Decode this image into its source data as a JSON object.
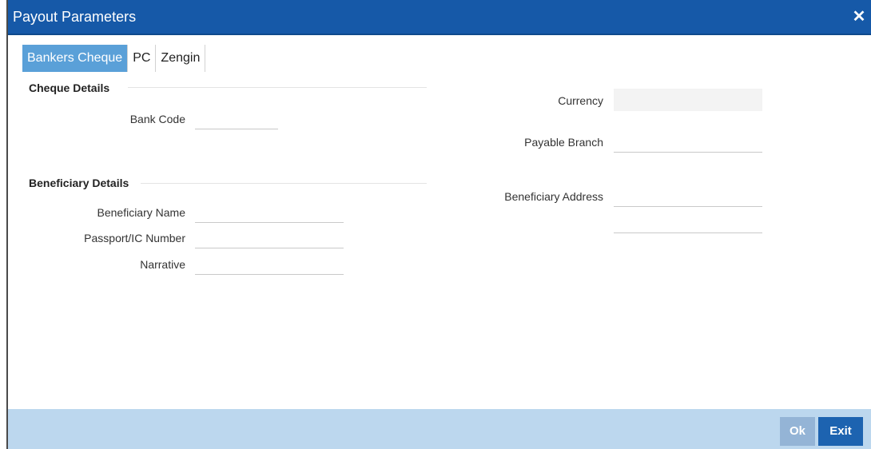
{
  "window": {
    "title": "Payout Parameters",
    "close_glyph": "✕"
  },
  "tabs": [
    {
      "label": "Bankers Cheque",
      "active": true
    },
    {
      "label": "PC",
      "active": false
    },
    {
      "label": "Zengin",
      "active": false
    }
  ],
  "cheque_details": {
    "heading": "Cheque Details",
    "bank_code": {
      "label": "Bank Code",
      "value": ""
    }
  },
  "right_fields": {
    "currency": {
      "label": "Currency",
      "value": ""
    },
    "payable_branch": {
      "label": "Payable Branch",
      "value": ""
    },
    "beneficiary_address": {
      "label": "Beneficiary Address",
      "line1": "",
      "line2": ""
    }
  },
  "beneficiary_details": {
    "heading": "Beneficiary Details",
    "name": {
      "label": "Beneficiary Name",
      "value": ""
    },
    "passport": {
      "label": "Passport/IC Number",
      "value": ""
    },
    "narrative": {
      "label": "Narrative",
      "value": ""
    }
  },
  "footer": {
    "ok_label": "Ok",
    "exit_label": "Exit"
  },
  "colors": {
    "titlebar": "#1659a8",
    "active_tab": "#5aa0d8",
    "footer": "#bcd7ee",
    "exit_button": "#1d63b0",
    "ok_button": "#94b4d6"
  }
}
